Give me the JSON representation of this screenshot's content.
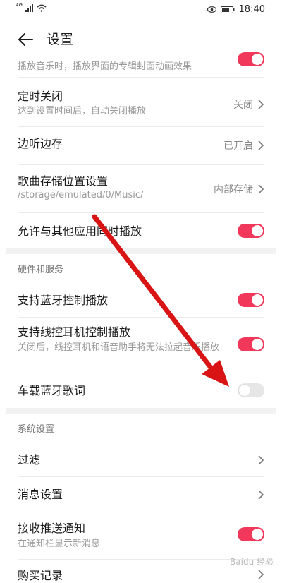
{
  "status": {
    "network": "4G",
    "time": "18:40"
  },
  "header": {
    "title": "设置"
  },
  "top_partial": {
    "subtitle": "播放音乐时，播放界面的专辑封面动画效果"
  },
  "rows": {
    "timer": {
      "title": "定时关闭",
      "subtitle": "达到设置时间后，自动关闭播放",
      "value": "关闭"
    },
    "cache": {
      "title": "边听边存",
      "value": "已开启"
    },
    "storage": {
      "title": "歌曲存储位置设置",
      "subtitle": "/storage/emulated/0/Music/",
      "value": "内部存储"
    },
    "mix": {
      "title": "允许与其他应用同时播放"
    }
  },
  "hardware": {
    "label": "硬件和服务",
    "bt": {
      "title": "支持蓝牙控制播放"
    },
    "wired": {
      "title": "支持线控耳机控制播放",
      "subtitle": "关闭后，线控耳机和语音助手将无法拉起音乐播放"
    },
    "car": {
      "title": "车载蓝牙歌词"
    }
  },
  "system": {
    "label": "系统设置",
    "filter": {
      "title": "过滤"
    },
    "notify": {
      "title": "消息设置"
    },
    "push": {
      "title": "接收推送通知",
      "subtitle": "在通知栏显示新消息"
    },
    "purchase": {
      "title": "购买记录"
    }
  },
  "colors": {
    "accent": "#f2385a",
    "arrow": "#d91414"
  },
  "watermark": "Baidu 经验"
}
